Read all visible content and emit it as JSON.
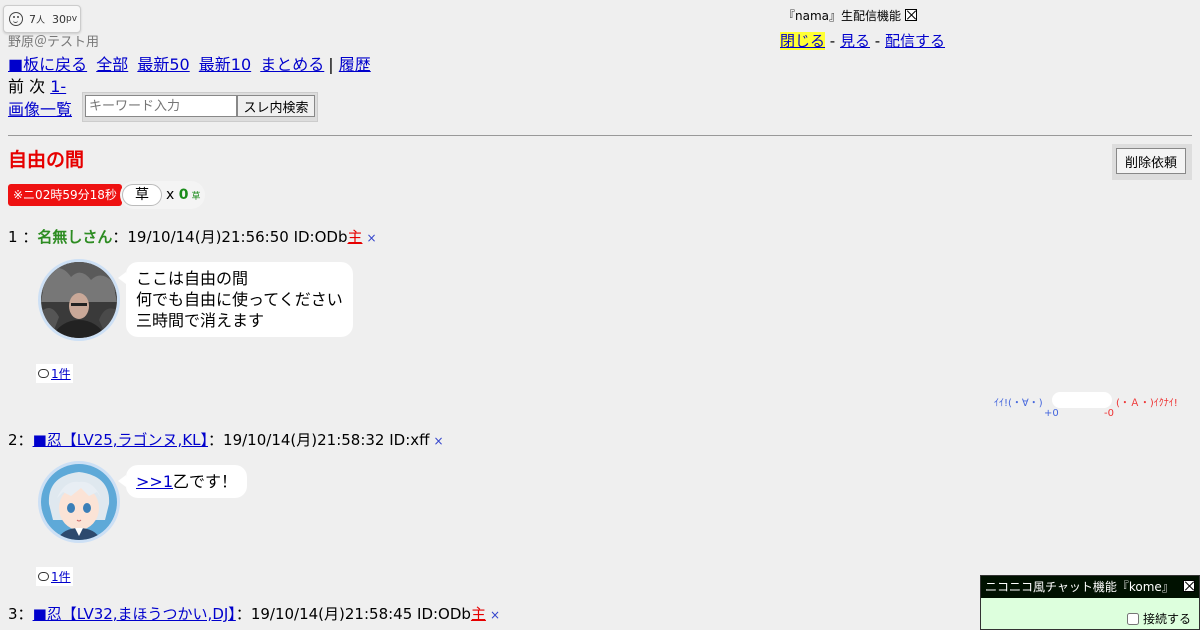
{
  "viewer": {
    "people": "7",
    "people_unit": "人",
    "pv": "30",
    "pv_unit": "pv"
  },
  "board": {
    "subtitle": "野原＠テスト用"
  },
  "nav": {
    "back": "■板に戻る",
    "all": "全部",
    "latest50": "最新50",
    "latest10": "最新10",
    "summary": "まとめる",
    "separator": "|",
    "history": "履歴"
  },
  "paging": {
    "prev": "前",
    "next": "次",
    "range": "1-"
  },
  "image_list": "画像一覧",
  "search": {
    "placeholder": "キーワード入力",
    "button": "スレ内検索"
  },
  "nama": {
    "title": "『nama』生配信機能",
    "close": "閉じる",
    "watch": "見る",
    "stream": "配信する",
    "sep": "-"
  },
  "thread": {
    "title": "自由の間",
    "delete_request": "削除依頼",
    "timer": "※ニ02時59分18秒",
    "kusa_button": "草",
    "kusa_x": "x",
    "kusa_count": "0",
    "kusa_small": "草"
  },
  "posts": [
    {
      "num": "1",
      "sep": "：",
      "name": "名無しさん",
      "date": "：19/10/14(月)21:56:50 ID:ODb",
      "owner": "主",
      "x": "×",
      "lines": [
        "ここは自由の間",
        "何でも自由に使ってください",
        "三時間で消えます"
      ],
      "replies": "1件"
    },
    {
      "num": "2",
      "sep": "：",
      "name": "■忍【LV25,ラゴンヌ,KL】",
      "date": "：19/10/14(月)21:58:32 ID:xff",
      "x": "×",
      "anchor": ">>1",
      "text": "乙です！",
      "replies": "1件"
    },
    {
      "num": "3",
      "sep": "：",
      "name": "■忍【LV32,まほうつかい,DJ】",
      "date": "：19/10/14(月)21:58:45 ID:ODb",
      "owner": "主",
      "x": "×"
    }
  ],
  "votes": {
    "good": "ｲｲ!(・∀・)",
    "bad": "(・Ａ・)ｲｸﾅｲ!",
    "plus": "+0",
    "minus": "-0"
  },
  "kome": {
    "title": "ニコニコ風チャット機能『kome』",
    "connect": "接続する"
  },
  "colors": {
    "title_red": "#e60000",
    "name_green": "#2d8c22",
    "link_blue": "#0000cc",
    "highlight": "#ffff33"
  }
}
